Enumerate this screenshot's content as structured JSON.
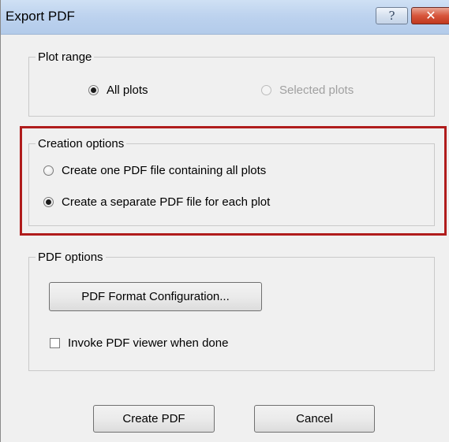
{
  "window": {
    "title": "Export PDF",
    "help_glyph": "?",
    "close_glyph": "✕"
  },
  "plot_range": {
    "legend": "Plot range",
    "options": [
      {
        "label": "All plots",
        "checked": true,
        "enabled": true
      },
      {
        "label": "Selected plots",
        "checked": false,
        "enabled": false
      }
    ]
  },
  "creation_options": {
    "legend": "Creation options",
    "options": [
      {
        "label": "Create one PDF file containing all plots",
        "checked": false
      },
      {
        "label": "Create a separate PDF file for each plot",
        "checked": true
      }
    ],
    "highlight_color": "#b01c1c"
  },
  "pdf_options": {
    "legend": "PDF options",
    "format_button": "PDF Format Configuration...",
    "invoke_viewer": {
      "label": "Invoke PDF viewer when done",
      "checked": false
    }
  },
  "buttons": {
    "create": "Create PDF",
    "cancel": "Cancel"
  }
}
